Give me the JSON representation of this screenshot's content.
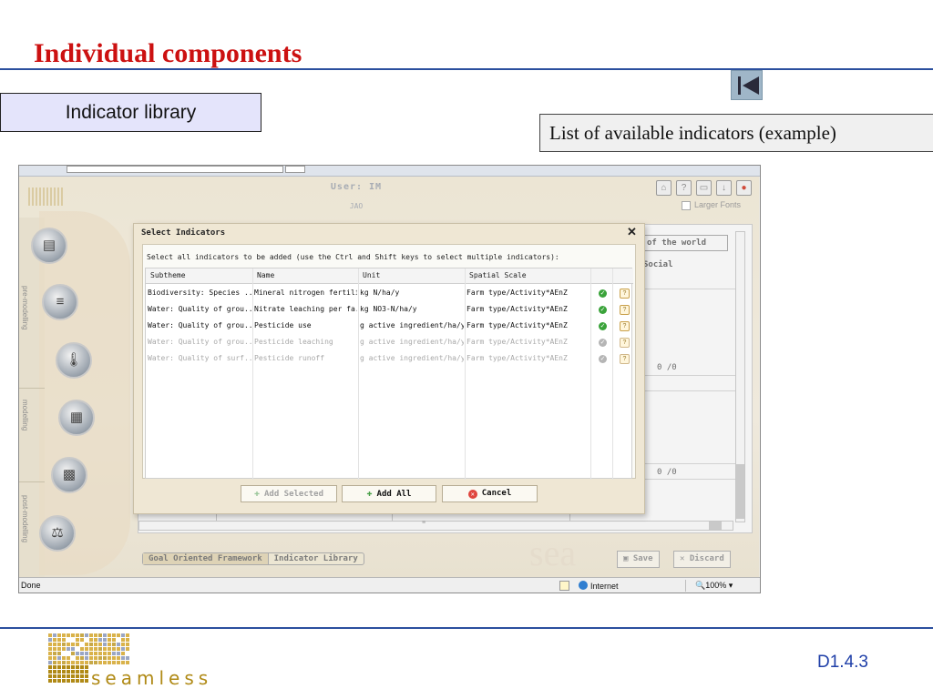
{
  "slide": {
    "title": "Individual components",
    "section_label": "Indicator library",
    "caption": "List of available indicators (example)",
    "logo_word": "seamless",
    "doc_id": "D1.4.3"
  },
  "app": {
    "user_label": "User: IM",
    "user_sub": "JAO",
    "larger_fonts": "Larger Fonts",
    "toolbar_icons": [
      "home-icon",
      "help-icon",
      "window-icon",
      "download-icon",
      "close-icon"
    ],
    "side_nav": [
      "pre-modelling",
      "modelling",
      "post-modelling"
    ],
    "background": {
      "world_button": "of the world",
      "social_header": "Social",
      "values": [
        "0 /0",
        "0 /0"
      ]
    },
    "tabs": [
      "Goal Oriented Framework",
      "Indicator Library"
    ],
    "save_label": "Save",
    "discard_label": "Discard",
    "brand_watermark": "sea"
  },
  "dialog": {
    "title": "Select Indicators",
    "close_glyph": "✕",
    "instructions": "Select all indicators to be added (use the Ctrl and Shift keys to select multiple indicators):",
    "columns": [
      "Subtheme",
      "Name",
      "Unit",
      "Spatial Scale"
    ],
    "rows": [
      {
        "subtheme": "Biodiversity: Species ...",
        "name": "Mineral nitrogen fertili...",
        "unit": "kg N/ha/y",
        "scale": "Farm type/Activity*AEnZ"
      },
      {
        "subtheme": "Water: Quality of grou...",
        "name": "Nitrate leaching per fa...",
        "unit": "kg NO3-N/ha/y",
        "scale": "Farm type/Activity*AEnZ"
      },
      {
        "subtheme": "Water: Quality of grou...",
        "name": "Pesticide use",
        "unit": "g active ingredient/ha/y",
        "scale": "Farm type/Activity*AEnZ"
      },
      {
        "subtheme": "Water: Quality of grou...",
        "name": "Pesticide leaching",
        "unit": "g active ingredient/ha/y",
        "scale": "Farm type/Activity*AEnZ"
      },
      {
        "subtheme": "Water: Quality of surf...",
        "name": "Pesticide runoff",
        "unit": "g active ingredient/ha/y",
        "scale": "Farm type/Activity*AEnZ"
      }
    ],
    "buttons": {
      "add_selected": "Add Selected",
      "add_all": "Add All",
      "cancel": "Cancel"
    }
  },
  "statusbar": {
    "left": "Done",
    "zone": "Internet",
    "zoom": "100%"
  },
  "colors": {
    "title_red": "#cc1111",
    "rule_blue": "#2b4f9e",
    "section_bg": "#e4e4fb",
    "logo_gold": "#b08a16",
    "doc_id_blue": "#1f3fa8",
    "ok_green": "#3aa33a",
    "cancel_red": "#e0453d"
  }
}
